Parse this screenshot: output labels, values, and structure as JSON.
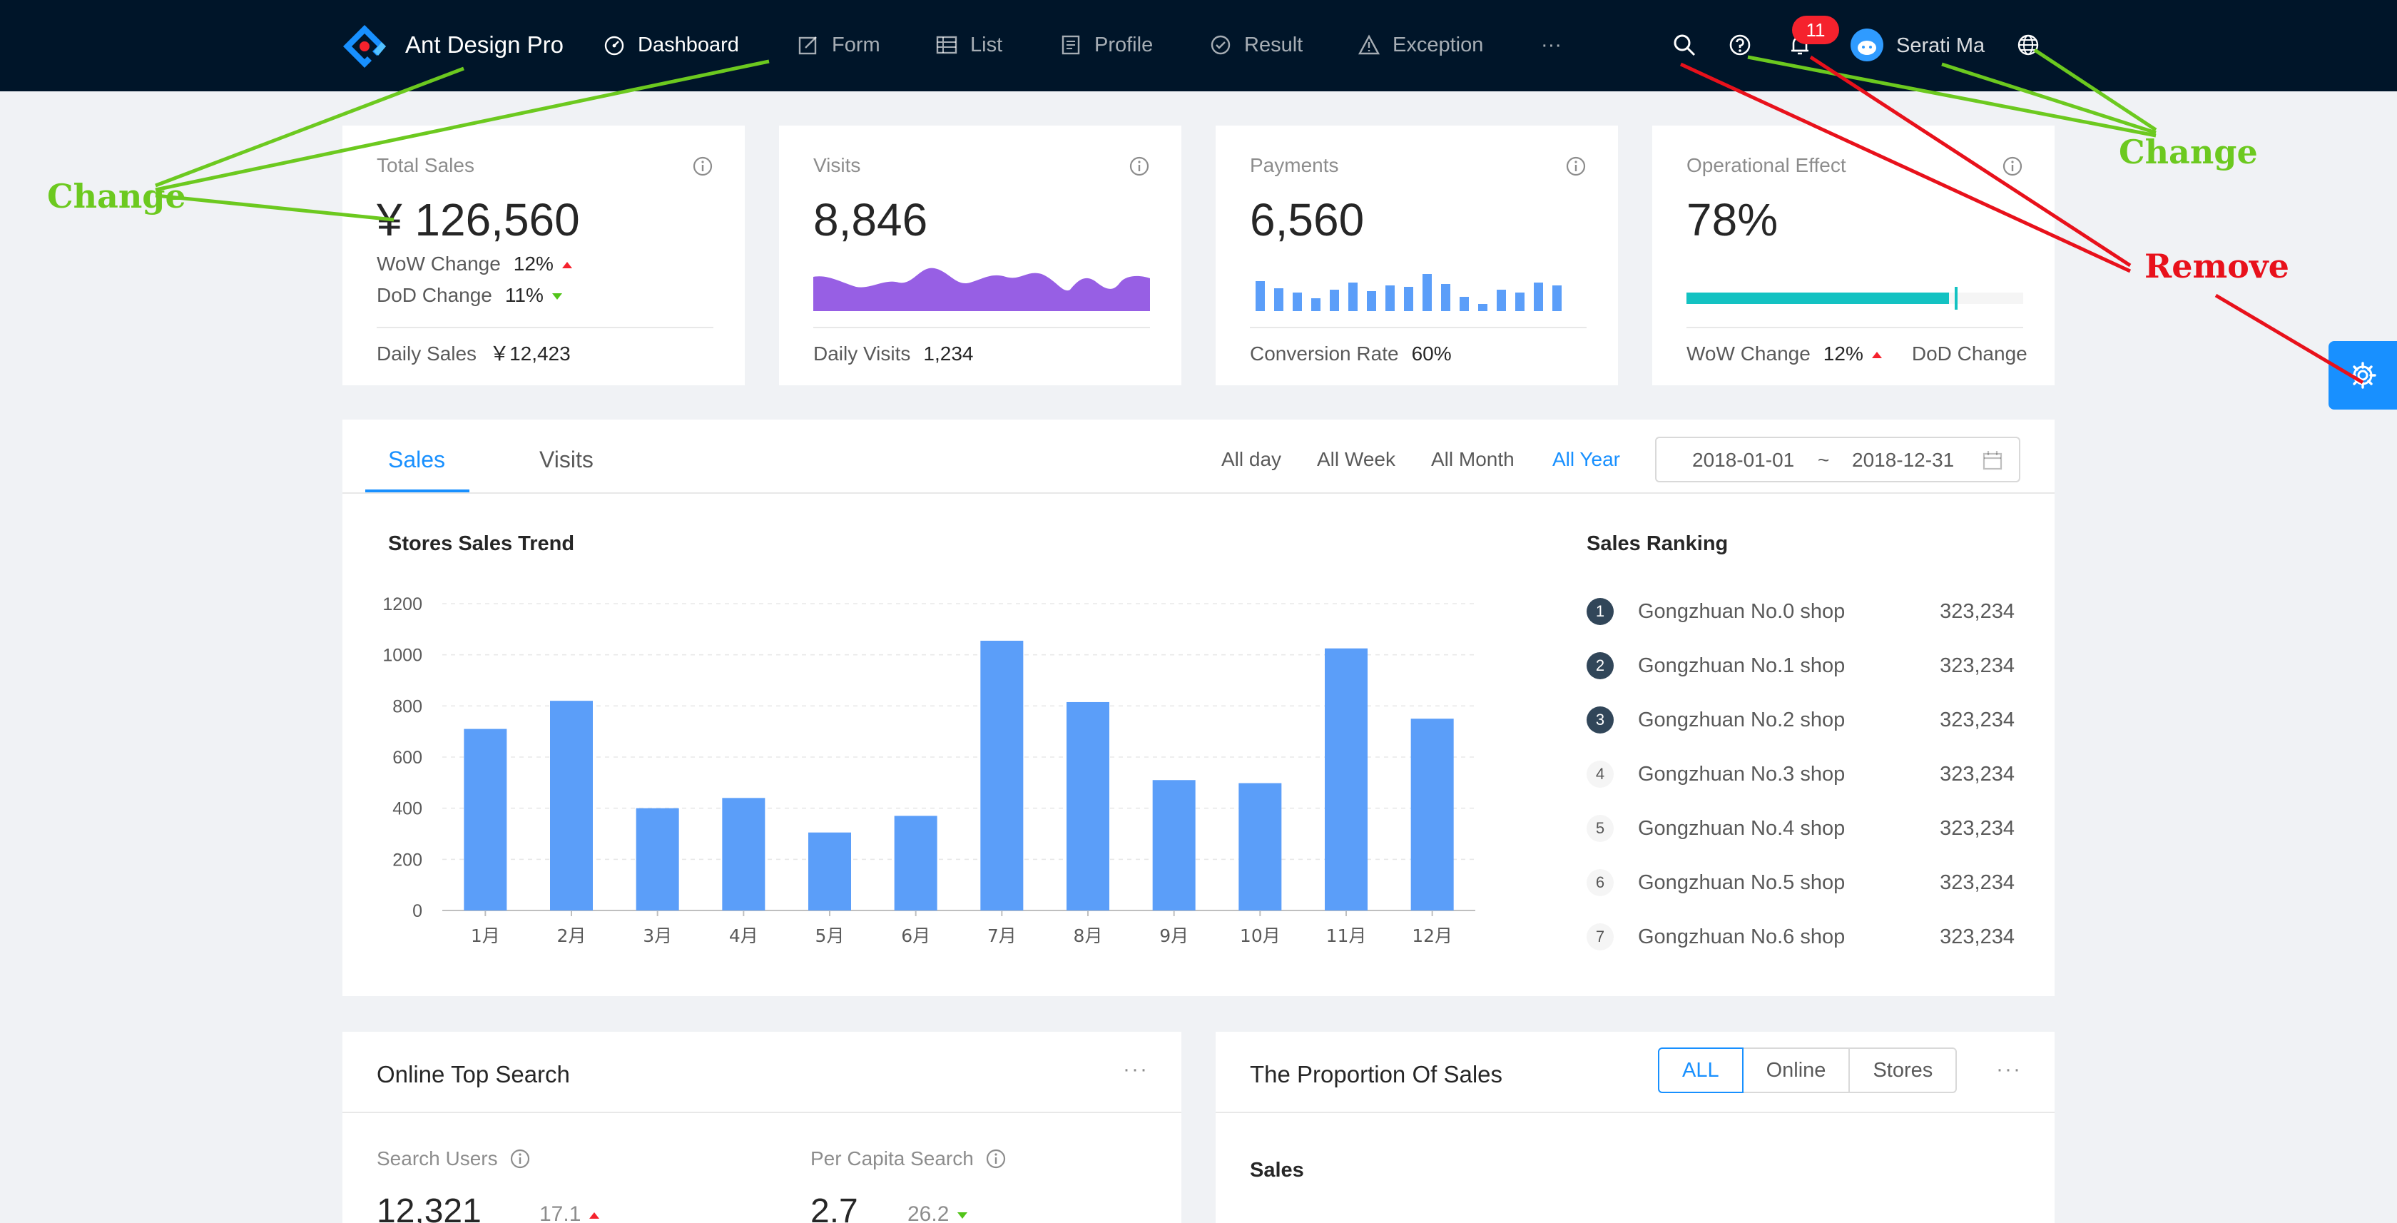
{
  "app": {
    "brand": "Ant Design Pro"
  },
  "nav": {
    "items": [
      {
        "label": "Dashboard",
        "icon": "dashboard-icon"
      },
      {
        "label": "Form",
        "icon": "form-icon"
      },
      {
        "label": "List",
        "icon": "table-icon"
      },
      {
        "label": "Profile",
        "icon": "profile-icon"
      },
      {
        "label": "Result",
        "icon": "check-circle-icon"
      },
      {
        "label": "Exception",
        "icon": "warning-icon"
      }
    ],
    "more": "···",
    "notification_count": "11",
    "user_name": "Serati Ma"
  },
  "kpis": [
    {
      "title": "Total Sales",
      "value": "¥ 126,560",
      "wow_label": "WoW Change",
      "wow_value": "12%",
      "dod_label": "DoD Change",
      "dod_value": "11%",
      "footer_label": "Daily Sales",
      "footer_value": "￥12,423"
    },
    {
      "title": "Visits",
      "value": "8,846",
      "footer_label": "Daily Visits",
      "footer_value": "1,234"
    },
    {
      "title": "Payments",
      "value": "6,560",
      "footer_label": "Conversion Rate",
      "footer_value": "60%"
    },
    {
      "title": "Operational Effect",
      "value": "78%",
      "progress": 0.78,
      "target": 0.8,
      "wow_label": "WoW Change",
      "wow_value": "12%",
      "dod_label": "DoD Change"
    }
  ],
  "sales": {
    "tabs": [
      "Sales",
      "Visits"
    ],
    "ranges": [
      "All day",
      "All Week",
      "All Month",
      "All Year"
    ],
    "date_start": "2018-01-01",
    "date_sep": "~",
    "date_end": "2018-12-31",
    "trend_title": "Stores Sales Trend",
    "ranking_title": "Sales Ranking",
    "ranking": [
      {
        "rank": "1",
        "name": "Gongzhuan No.0 shop",
        "value": "323,234"
      },
      {
        "rank": "2",
        "name": "Gongzhuan No.1 shop",
        "value": "323,234"
      },
      {
        "rank": "3",
        "name": "Gongzhuan No.2 shop",
        "value": "323,234"
      },
      {
        "rank": "4",
        "name": "Gongzhuan No.3 shop",
        "value": "323,234"
      },
      {
        "rank": "5",
        "name": "Gongzhuan No.4 shop",
        "value": "323,234"
      },
      {
        "rank": "6",
        "name": "Gongzhuan No.5 shop",
        "value": "323,234"
      },
      {
        "rank": "7",
        "name": "Gongzhuan No.6 shop",
        "value": "323,234"
      }
    ]
  },
  "chart_data": {
    "type": "bar",
    "categories": [
      "1月",
      "2月",
      "3月",
      "4月",
      "5月",
      "6月",
      "7月",
      "8月",
      "9月",
      "10月",
      "11月",
      "12月"
    ],
    "values": [
      710,
      820,
      400,
      440,
      305,
      370,
      1055,
      815,
      510,
      498,
      1025,
      750
    ],
    "yticks": [
      "0",
      "200",
      "400",
      "600",
      "800",
      "1000",
      "1200"
    ],
    "ylim": [
      0,
      1200
    ],
    "color": "#5b9ef9",
    "grid": true
  },
  "top_search": {
    "title": "Online Top Search",
    "more": "···",
    "users_label": "Search Users",
    "users_value": "12,321",
    "users_change": "17.1",
    "per_capita_label": "Per Capita Search",
    "per_capita_value": "2.7",
    "per_capita_change": "26.2"
  },
  "proportion": {
    "title": "The Proportion Of Sales",
    "options": [
      "ALL",
      "Online",
      "Stores"
    ],
    "more": "···",
    "sub_title": "Sales"
  },
  "annotations": {
    "change_left": "Change",
    "change_right": "Change",
    "remove": "Remove"
  },
  "colors": {
    "header_bg": "#001529",
    "primary": "#1890ff",
    "visits_area": "#975fe4",
    "payments_bar": "#5b9ef9",
    "progress": "#13c2c2",
    "annotation_green": "#6cc91f",
    "annotation_red": "#e8111b"
  }
}
